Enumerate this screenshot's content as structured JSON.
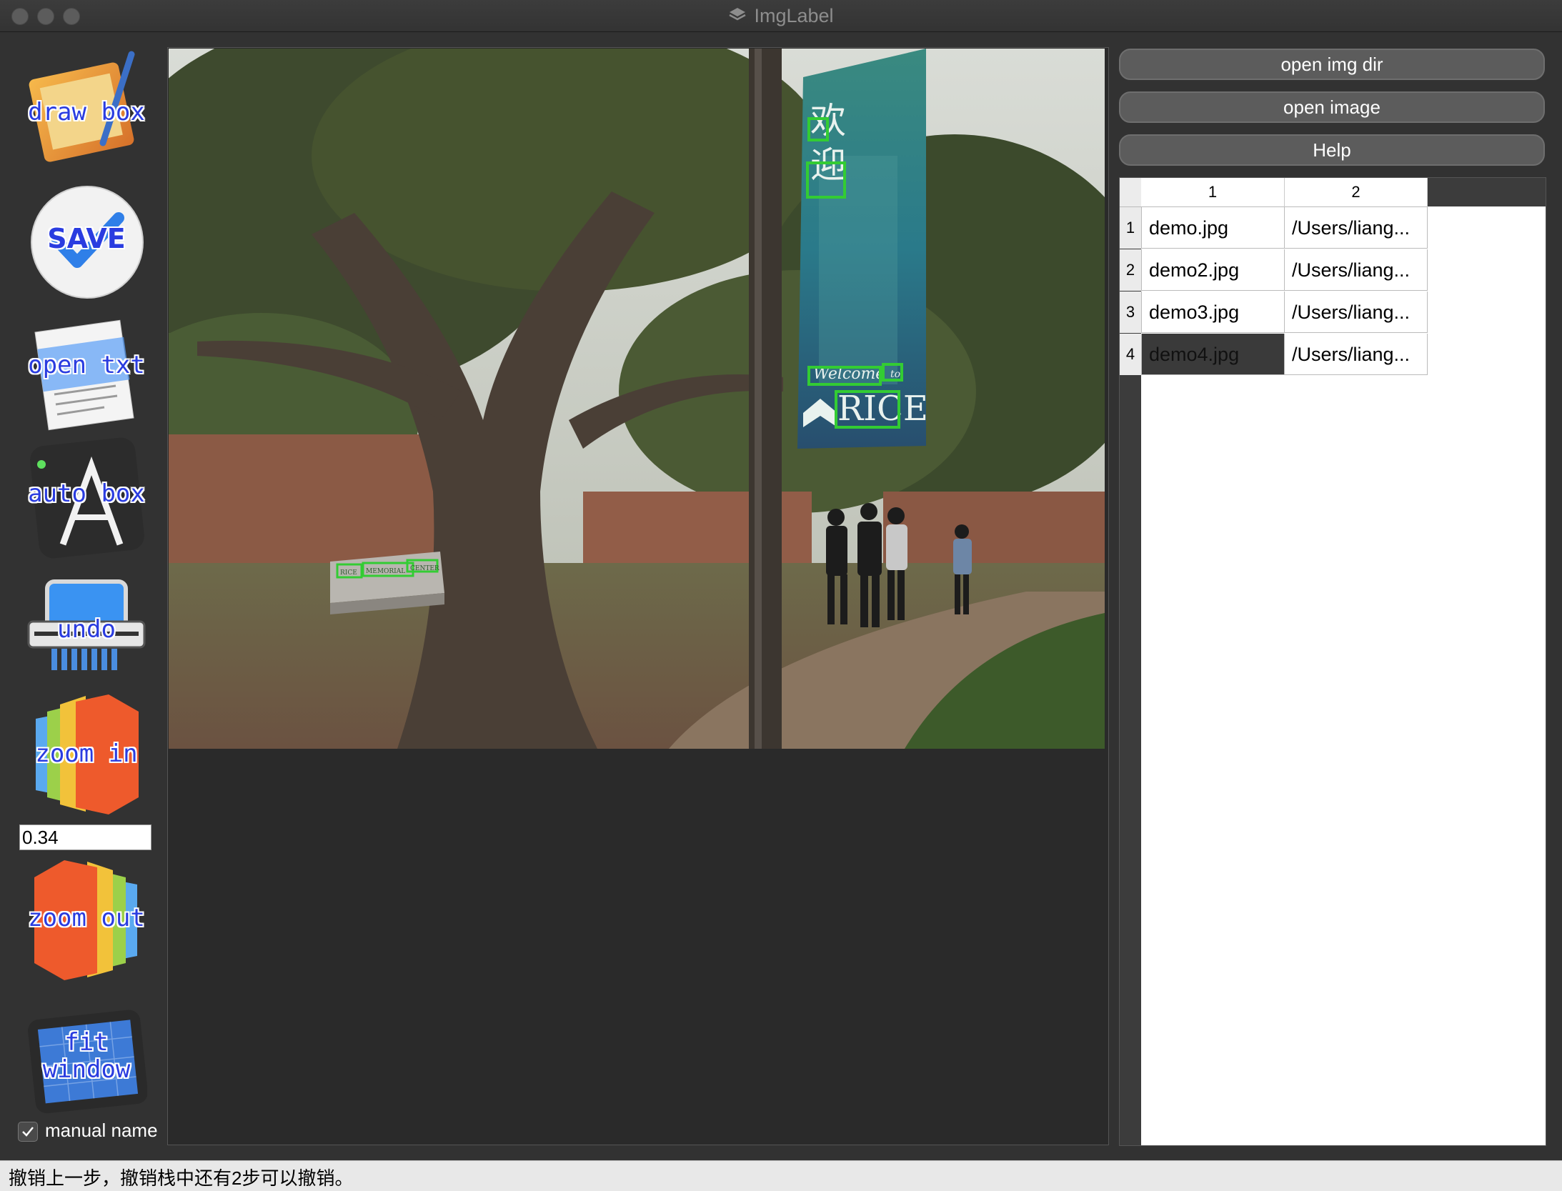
{
  "window": {
    "title": "ImgLabel"
  },
  "toolbar": {
    "draw_box": "draw box",
    "save": "SAVE",
    "open_txt": "open txt",
    "auto_box": "auto box",
    "undo": "undo",
    "zoom_in": "zoom in",
    "zoom_value": "0.34",
    "zoom_out": "zoom out",
    "fit_window_1": "fit",
    "fit_window_2": "window",
    "manual_name": "manual name",
    "manual_name_checked": true
  },
  "image_text": {
    "banner_cn_1": "欢",
    "banner_cn_2": "迎",
    "banner_welcome": "Welcome",
    "banner_to": "to",
    "banner_rice": "RICE",
    "sign_1": "RICE",
    "sign_2": "MEMORIAL",
    "sign_3": "CENTER"
  },
  "right_panel": {
    "open_img_dir": "open img dir",
    "open_image": "open image",
    "help": "Help"
  },
  "table": {
    "headers": [
      "1",
      "2"
    ],
    "rows": [
      {
        "index": "1",
        "name": "demo.jpg",
        "path": "/Users/liang..."
      },
      {
        "index": "2",
        "name": "demo2.jpg",
        "path": "/Users/liang..."
      },
      {
        "index": "3",
        "name": "demo3.jpg",
        "path": "/Users/liang..."
      },
      {
        "index": "4",
        "name": "demo4.jpg",
        "path": "/Users/liang..."
      }
    ],
    "selected_row": 4
  },
  "status": "撤销上一步，撤销栈中还有2步可以撤销。",
  "colors": {
    "box_green": "#33cc33",
    "label_blue": "#2a3ce0",
    "selected_cell": "#3a3a3a"
  }
}
